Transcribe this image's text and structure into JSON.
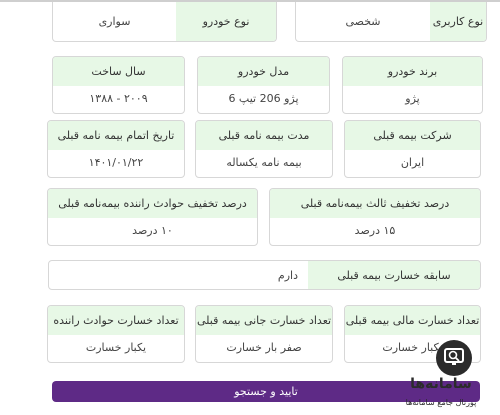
{
  "vehicle_usage": {
    "label": "نوع کاربری",
    "value": "شخصی"
  },
  "vehicle_type": {
    "label": "نوع خودرو",
    "value": "سواری"
  },
  "row1": [
    {
      "label": "برند خودرو",
      "value": "پژو"
    },
    {
      "label": "مدل خودرو",
      "value": "پژو 206 تیپ 6"
    },
    {
      "label": "سال ساخت",
      "value": "۲۰۰۹ - ۱۳۸۸"
    }
  ],
  "row2": [
    {
      "label": "شرکت بیمه قبلی",
      "value": "ایران"
    },
    {
      "label": "مدت بیمه نامه قبلی",
      "value": "بیمه نامه یکساله"
    },
    {
      "label": "تاریخ اتمام بیمه نامه قبلی",
      "value": "۱۴۰۱/۰۱/۲۲"
    }
  ],
  "row3": [
    {
      "label": "درصد تخفیف ثالث بیمه‌نامه قبلی",
      "value": "۱۵ درصد"
    },
    {
      "label": "درصد تخفیف حوادث راننده بیمه‌نامه قبلی",
      "value": "۱۰ درصد"
    }
  ],
  "loss_history": {
    "label": "سابقه خسارت بیمه قبلی",
    "value": "دارم"
  },
  "row4": [
    {
      "label": "تعداد خسارت مالی بیمه قبلی",
      "value": "یکبار خسارت"
    },
    {
      "label": "تعداد خسارت جانی بیمه قبلی",
      "value": "صفر بار خسارت"
    },
    {
      "label": "تعداد خسارت حوادث راننده",
      "value": "یکبار خسارت"
    }
  ],
  "submit_label": "تایید و جستجو",
  "watermark": {
    "brand": "سامانه‌ها",
    "tagline": "پورتال جامع سامانه‌ها"
  },
  "colors": {
    "accent": "#5e2a86",
    "label_bg": "#e7f8e6"
  }
}
